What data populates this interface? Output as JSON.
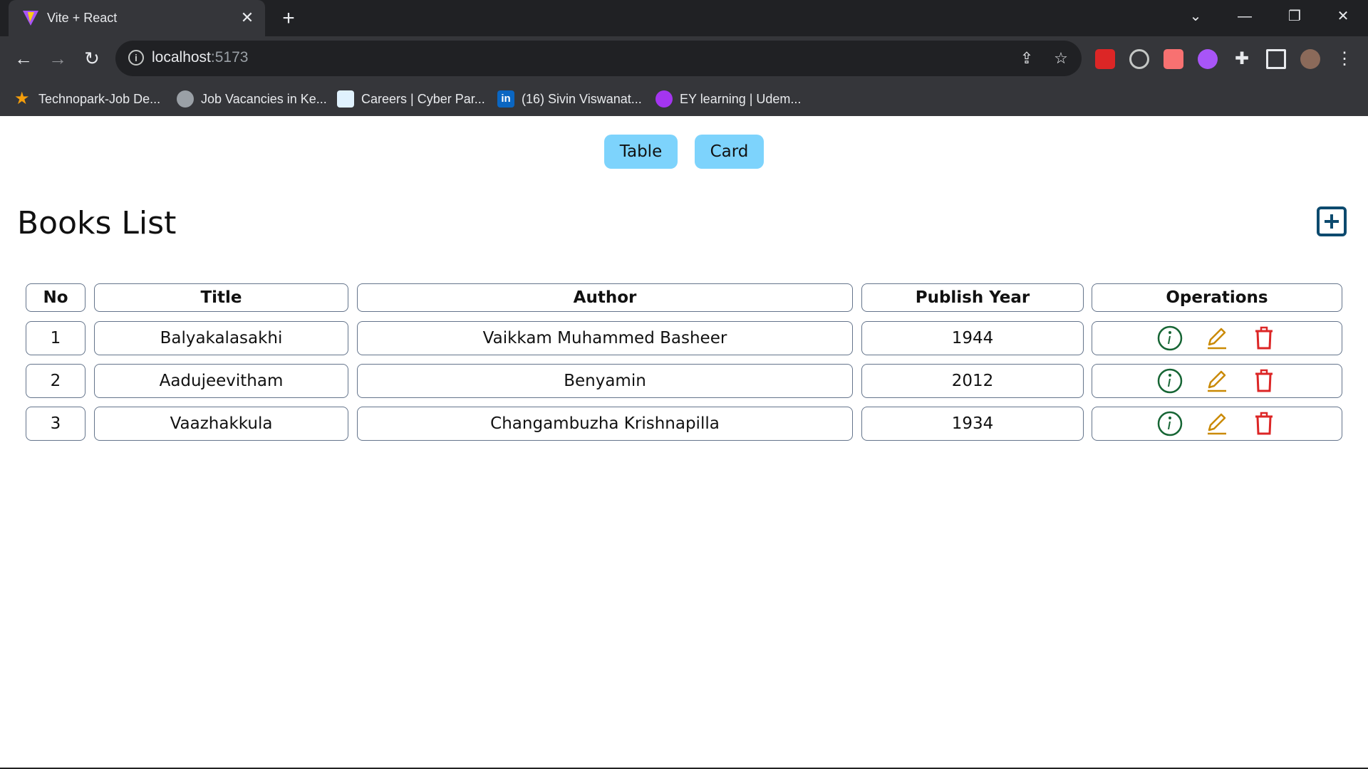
{
  "browser": {
    "tab_title": "Vite + React",
    "url_host": "localhost",
    "url_port": ":5173",
    "bookmarks": [
      "Technopark-Job De...",
      "Job Vacancies in Ke...",
      "Careers | Cyber Par...",
      "(16) Sivin Viswanat...",
      "EY learning | Udem..."
    ]
  },
  "view_toggle": {
    "table_label": "Table",
    "card_label": "Card"
  },
  "page": {
    "title": "Books List"
  },
  "table": {
    "headers": [
      "No",
      "Title",
      "Author",
      "Publish Year",
      "Operations"
    ],
    "rows": [
      {
        "no": "1",
        "title": "Balyakalasakhi",
        "author": "Vaikkam Muhammed Basheer",
        "year": "1944"
      },
      {
        "no": "2",
        "title": "Aadujeevitham",
        "author": "Benyamin",
        "year": "2012"
      },
      {
        "no": "3",
        "title": "Vaazhakkula",
        "author": "Changambuzha Krishnapilla",
        "year": "1934"
      }
    ]
  },
  "icons": {
    "add": "plus-square-icon",
    "info": "info-circle-icon",
    "edit": "pencil-icon",
    "delete": "trash-icon"
  },
  "colors": {
    "toggle_bg": "#7dd3fc",
    "add_icon": "#0c4a6e",
    "info_icon": "#166534",
    "edit_icon": "#ca8a04",
    "delete_icon": "#dc2626"
  }
}
